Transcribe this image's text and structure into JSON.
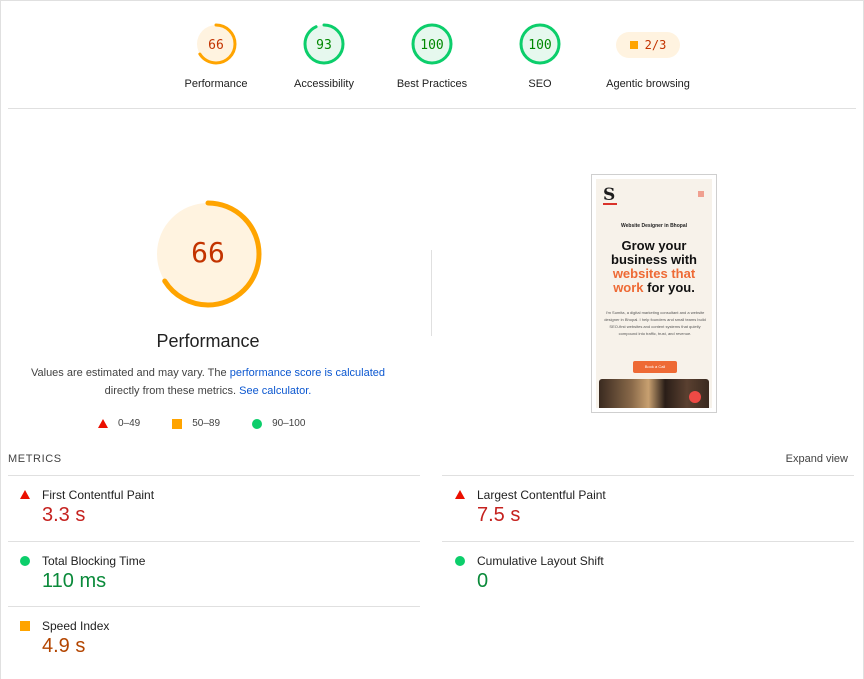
{
  "categories": [
    {
      "score": "66",
      "label": "Performance",
      "color": "#ffa400",
      "track": "#fff3e0",
      "text": "#c33300",
      "fraction": 0.66
    },
    {
      "score": "93",
      "label": "Accessibility",
      "color": "#0cce6b",
      "track": "#e6f8ee",
      "text": "#008800",
      "fraction": 0.93
    },
    {
      "score": "100",
      "label": "Best Practices",
      "color": "#0cce6b",
      "track": "#e6f8ee",
      "text": "#008800",
      "fraction": 1.0
    },
    {
      "score": "100",
      "label": "SEO",
      "color": "#0cce6b",
      "track": "#e6f8ee",
      "text": "#008800",
      "fraction": 1.0
    }
  ],
  "agentic": {
    "fraction_text": "2/3",
    "label": "Agentic browsing"
  },
  "performance": {
    "score": "66",
    "fraction": 0.66,
    "title": "Performance",
    "note_pre": "Values are estimated and may vary. The ",
    "note_link1": "performance score is calculated",
    "note_mid": "directly from these metrics. ",
    "note_link2": "See calculator."
  },
  "legend": {
    "fail": "0–49",
    "average": "50–89",
    "pass": "90–100"
  },
  "thumbnail": {
    "logo": "S",
    "subtitle": "Website Designer in Bhopal",
    "headline_1": "Grow your",
    "headline_2": "business with",
    "headline_3": "websites that",
    "headline_4": "work",
    "headline_5": " for you.",
    "body": "I'm Sumita, a digital marketing consultant and a website designer in Bhopal. I help founders and small teams build SEO-first websites and content systems that quietly compound into traffic, trust, and revenue.",
    "button": "Book a Call"
  },
  "metrics": {
    "heading": "METRICS",
    "expand": "Expand view",
    "items": [
      {
        "title": "First Contentful Paint",
        "value": "3.3 s",
        "rating": "fail"
      },
      {
        "title": "Largest Contentful Paint",
        "value": "7.5 s",
        "rating": "fail"
      },
      {
        "title": "Total Blocking Time",
        "value": "110 ms",
        "rating": "pass"
      },
      {
        "title": "Cumulative Layout Shift",
        "value": "0",
        "rating": "pass"
      },
      {
        "title": "Speed Index",
        "value": "4.9 s",
        "rating": "average"
      }
    ]
  },
  "colors": {
    "fail": "#eb0f00",
    "average": "#ffa400",
    "pass": "#0cce6b"
  }
}
